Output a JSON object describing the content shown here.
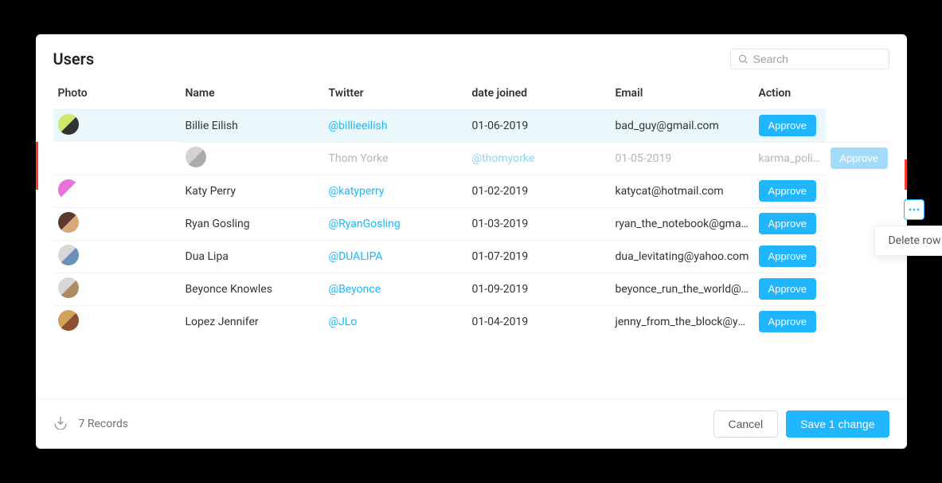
{
  "title": "Users",
  "search": {
    "placeholder": "Search"
  },
  "columns": {
    "photo": "Photo",
    "name": "Name",
    "twitter": "Twitter",
    "date_joined": "date joined",
    "email": "Email",
    "action": "Action"
  },
  "action_label": "Approve",
  "rows": [
    {
      "name": "Billie Eilish",
      "twitter": "@billieeilish",
      "date_joined": "01-06-2019",
      "email": "bad_guy@gmail.com",
      "state": "highlight",
      "avatar_colors": [
        "#cfe86b",
        "#333"
      ]
    },
    {
      "name": "Thom Yorke",
      "twitter": "@thomyorke",
      "date_joined": "01-05-2019",
      "email": "karma_police_thom@hotmail.com",
      "state": "deleted",
      "avatar_colors": [
        "#bfbfbf",
        "#888"
      ]
    },
    {
      "name": "Katy Perry",
      "twitter": "@katyperry",
      "date_joined": "01-02-2019",
      "email": "katycat@hotmail.com",
      "state": "normal",
      "avatar_colors": [
        "#e872d9",
        "#fff"
      ]
    },
    {
      "name": "Ryan Gosling",
      "twitter": "@RyanGosling",
      "date_joined": "01-03-2019",
      "email": "ryan_the_notebook@gmail.com",
      "state": "normal",
      "avatar_colors": [
        "#5a3a2e",
        "#d9a77a"
      ]
    },
    {
      "name": "Dua Lipa",
      "twitter": "@DUALIPA",
      "date_joined": "01-07-2019",
      "email": "dua_levitating@yahoo.com",
      "state": "normal",
      "avatar_colors": [
        "#d8d8d8",
        "#6a90b5"
      ]
    },
    {
      "name": "Beyonce Knowles",
      "twitter": "@Beyonce",
      "date_joined": "01-09-2019",
      "email": "beyonce_run_the_world@hotmail.com",
      "state": "normal",
      "avatar_colors": [
        "#d8d8d8",
        "#b08b5e"
      ]
    },
    {
      "name": "Lopez Jennifer",
      "twitter": "@JLo",
      "date_joined": "01-04-2019",
      "email": "jenny_from_the_block@yahoo.com",
      "state": "normal",
      "avatar_colors": [
        "#d4a15a",
        "#8a5030"
      ]
    }
  ],
  "context_menu": {
    "delete_row": "Delete row"
  },
  "footer": {
    "records": "7 Records",
    "cancel": "Cancel",
    "save": "Save 1 change"
  }
}
